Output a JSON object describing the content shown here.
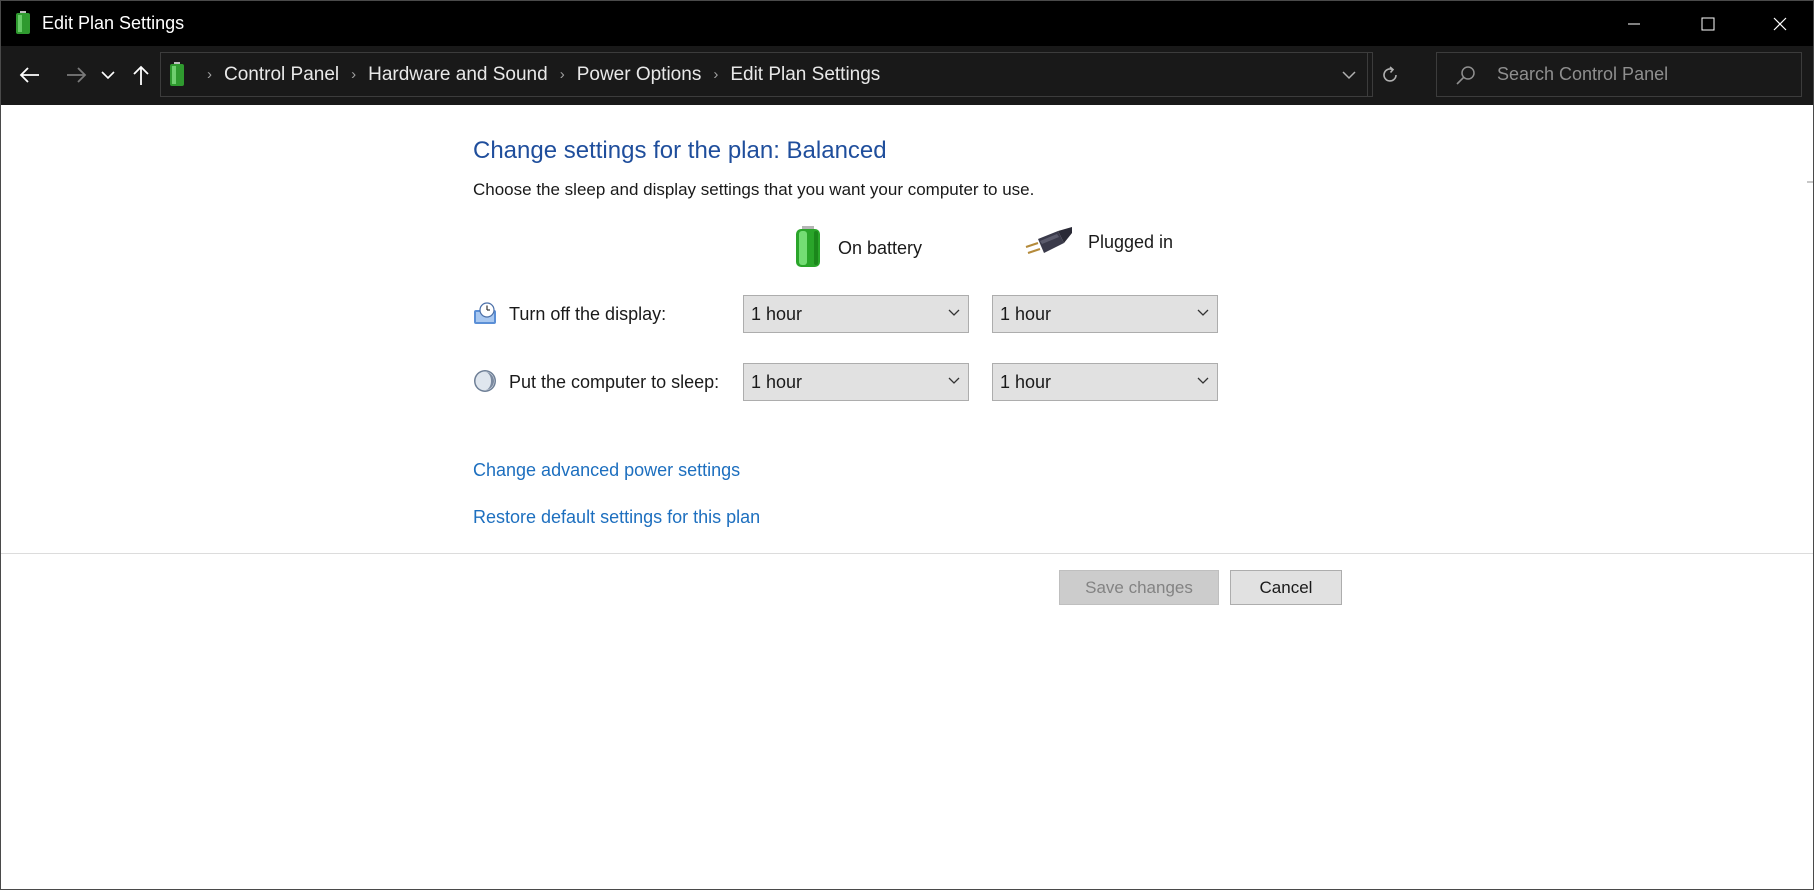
{
  "window": {
    "title": "Edit Plan Settings"
  },
  "address_bar": {
    "breadcrumbs": [
      "Control Panel",
      "Hardware and Sound",
      "Power Options",
      "Edit Plan Settings"
    ]
  },
  "search": {
    "placeholder": "Search Control Panel"
  },
  "content": {
    "heading": "Change settings for the plan: Balanced",
    "subtext": "Choose the sleep and display settings that you want your computer to use.",
    "columns": {
      "battery": "On battery",
      "plugged": "Plugged in"
    },
    "rows": [
      {
        "label": "Turn off the display:",
        "battery": "1 hour",
        "plugged": "1 hour"
      },
      {
        "label": "Put the computer to sleep:",
        "battery": "1 hour",
        "plugged": "1 hour"
      }
    ],
    "links": {
      "advanced": "Change advanced power settings",
      "restore": "Restore default settings for this plan"
    }
  },
  "buttons": {
    "save": "Save changes",
    "cancel": "Cancel"
  },
  "icons": {
    "app": "battery-icon",
    "back": "arrow-left-icon",
    "forward": "arrow-right-icon",
    "recent": "chevron-down-icon",
    "up": "arrow-up-icon",
    "refresh": "refresh-icon",
    "search": "search-icon",
    "display": "display-clock-icon",
    "sleep": "moon-icon",
    "battery_column": "battery-icon",
    "plug_column": "power-plug-icon"
  },
  "colors": {
    "titlebar": "#000000",
    "navbar": "#191919",
    "heading": "#1f4e9c",
    "link": "#1d6fbf"
  }
}
